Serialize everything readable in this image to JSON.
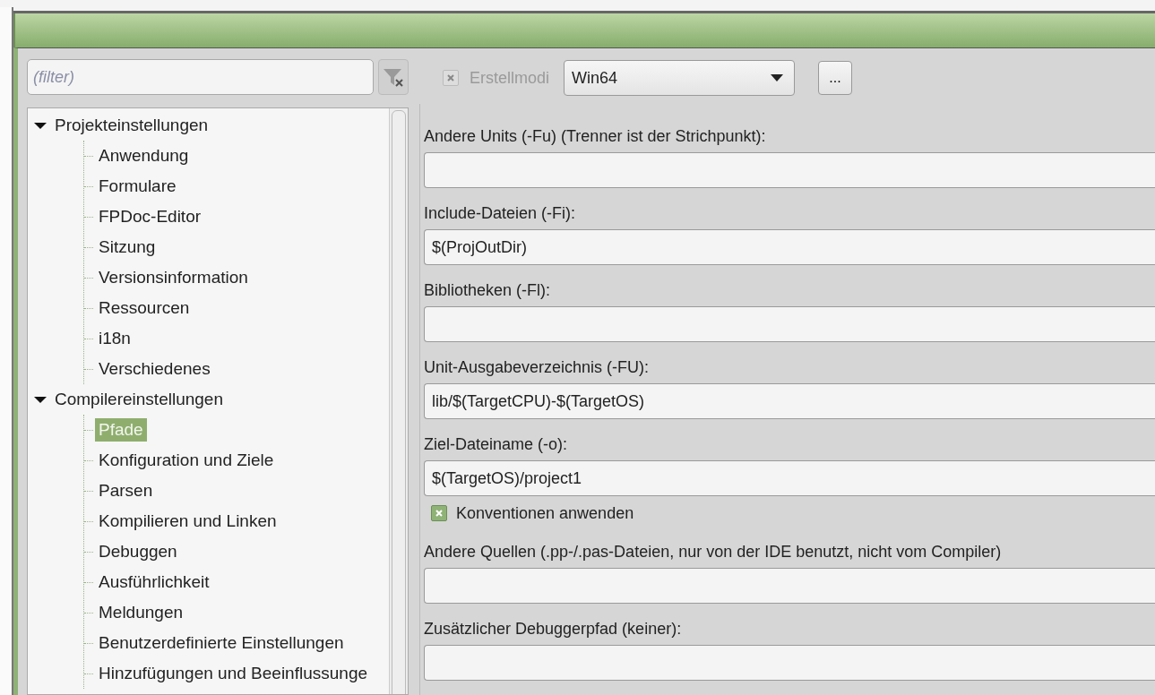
{
  "filter": {
    "placeholder": "(filter)"
  },
  "tree": [
    {
      "label": "Projekteinstellungen",
      "expanded": true,
      "selected": false,
      "children": [
        {
          "label": "Anwendung",
          "selected": false
        },
        {
          "label": "Formulare",
          "selected": false
        },
        {
          "label": "FPDoc-Editor",
          "selected": false
        },
        {
          "label": "Sitzung",
          "selected": false
        },
        {
          "label": "Versionsinformation",
          "selected": false
        },
        {
          "label": "Ressourcen",
          "selected": false
        },
        {
          "label": "i18n",
          "selected": false
        },
        {
          "label": "Verschiedenes",
          "selected": false
        }
      ]
    },
    {
      "label": "Compilereinstellungen",
      "expanded": true,
      "selected": false,
      "children": [
        {
          "label": "Pfade",
          "selected": true
        },
        {
          "label": "Konfiguration und Ziele",
          "selected": false
        },
        {
          "label": "Parsen",
          "selected": false
        },
        {
          "label": "Kompilieren und Linken",
          "selected": false
        },
        {
          "label": "Debuggen",
          "selected": false
        },
        {
          "label": "Ausführlichkeit",
          "selected": false
        },
        {
          "label": "Meldungen",
          "selected": false
        },
        {
          "label": "Benutzerdefinierte Einstellungen",
          "selected": false
        },
        {
          "label": "Hinzufügungen und Beeinflussunge",
          "selected": false
        }
      ]
    }
  ],
  "build_modes": {
    "label": "Erstellmodi",
    "checked": true,
    "disabled": true,
    "value": "Win64",
    "more_button": "..."
  },
  "fields": [
    {
      "kind": "field",
      "label": "Andere Units (-Fu) (Trenner ist der Strichpunkt):"
    },
    {
      "kind": "field",
      "label": "Include-Dateien (-Fi):",
      "value": "$(ProjOutDir)"
    },
    {
      "kind": "field",
      "label": "Bibliotheken (-Fl):"
    },
    {
      "kind": "field",
      "label": "Unit-Ausgabeverzeichnis (-FU):",
      "value": "lib/$(TargetCPU)-$(TargetOS)"
    },
    {
      "kind": "field",
      "label": "Ziel-Dateiname (-o):",
      "value": "$(TargetOS)/project1"
    },
    {
      "kind": "checkbox",
      "label": "Konventionen anwenden",
      "checked": true
    },
    {
      "kind": "field",
      "label": "Andere Quellen (.pp-/.pas-Dateien, nur von der IDE benutzt, nicht vom Compiler)"
    },
    {
      "kind": "field",
      "label": "Zusätzlicher Debuggerpfad (keiner):"
    }
  ]
}
